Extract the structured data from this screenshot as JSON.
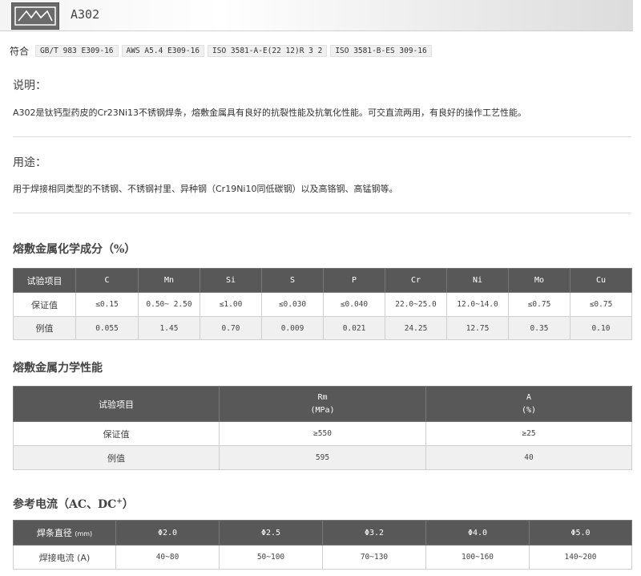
{
  "header": {
    "title": "A302"
  },
  "standards": {
    "label": "符合",
    "items": [
      "GB/T 983 E309-16",
      "AWS A5.4 E309-16",
      "ISO 3581-A-E(22 12)R 3 2",
      "ISO 3581-B-ES 309-16"
    ]
  },
  "description": {
    "heading": "说明：",
    "text": "A302是钛钙型药皮的Cr23Ni13不锈钢焊条，熔敷金属具有良好的抗裂性能及抗氧化性能。可交直流两用，有良好的操作工艺性能。"
  },
  "usage": {
    "heading": "用途：",
    "text": "用于焊接相同类型的不锈钢、不锈钢衬里、异种钢（Cr19Ni10同低碳钢）以及高铬钢、高锰钢等。"
  },
  "chemistry": {
    "heading": "熔敷金属化学成分（%）",
    "headers": [
      "试验项目",
      "C",
      "Mn",
      "Si",
      "S",
      "P",
      "Cr",
      "Ni",
      "Mo",
      "Cu"
    ],
    "rows": [
      [
        "保证值",
        "≤0.15",
        "0.50~ 2.50",
        "≤1.00",
        "≤0.030",
        "≤0.040",
        "22.0~25.0",
        "12.0~14.0",
        "≤0.75",
        "≤0.75"
      ],
      [
        "例值",
        "0.055",
        "1.45",
        "0.70",
        "0.009",
        "0.021",
        "24.25",
        "12.75",
        "0.35",
        "0.10"
      ]
    ]
  },
  "mechanical": {
    "heading": "熔敷金属力学性能",
    "headers": [
      {
        "name": "试验项目",
        "unit": ""
      },
      {
        "name": "Rm",
        "unit": "(MPa)"
      },
      {
        "name": "A",
        "unit": "(%)"
      }
    ],
    "rows": [
      [
        "保证值",
        "≥550",
        "≥25"
      ],
      [
        "例值",
        "595",
        "40"
      ]
    ]
  },
  "current": {
    "heading": "参考电流（AC、DC",
    "heading_sup": "+",
    "heading_end": "）",
    "diameter_label": "焊条直径",
    "diameter_unit": "(mm)",
    "diameters": [
      "Φ2.0",
      "Φ2.5",
      "Φ3.2",
      "Φ4.0",
      "Φ5.0"
    ],
    "current_label": "焊接电流 (A)",
    "currents": [
      "40~80",
      "50~100",
      "70~130",
      "100~160",
      "140~200"
    ]
  }
}
